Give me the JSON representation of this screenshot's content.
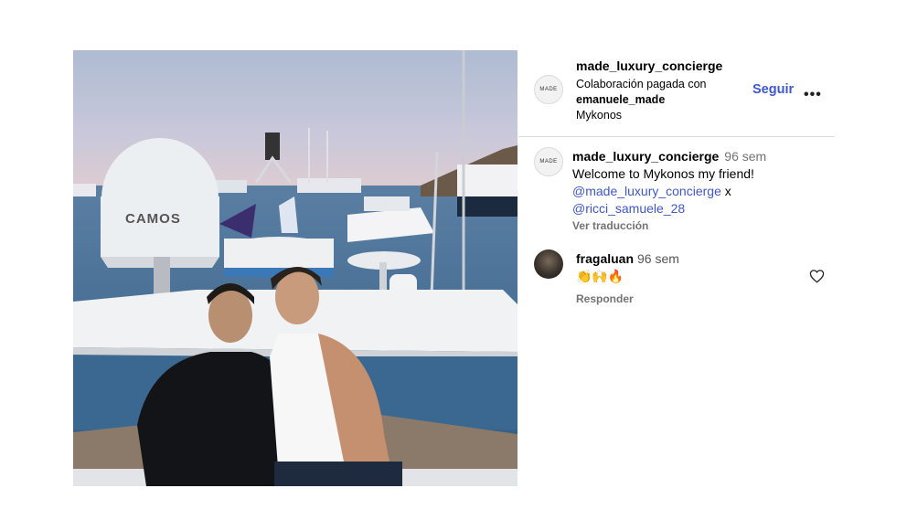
{
  "post": {
    "image_alt": "Two men sitting on a yacht in Mykonos harbor at dusk",
    "dome_text": "CAMOS"
  },
  "header": {
    "username": "made_luxury_concierge",
    "collab_text": "Colaboración pagada con",
    "collab_user": "emanuele_made",
    "location": "Mykonos",
    "follow_label": "Seguir",
    "more_label": "•••",
    "avatar_text": "MADE"
  },
  "caption": {
    "username": "made_luxury_concierge",
    "time": "96 sem",
    "text": "Welcome to Mykonos my friend!",
    "mention1": "@made_luxury_concierge",
    "joiner": "x",
    "mention2": "@ricci_samuele_28",
    "translate_label": "Ver traducción",
    "avatar_text": "MADE"
  },
  "comments": [
    {
      "username": "fragaluan",
      "time": "96 sem",
      "text": "👏🙌🔥",
      "reply_label": "Responder"
    }
  ],
  "colors": {
    "link": "#3d58c9",
    "muted": "#737373",
    "divider": "#dbdbdb"
  },
  "icons": [
    "more-icon",
    "heart-icon"
  ]
}
